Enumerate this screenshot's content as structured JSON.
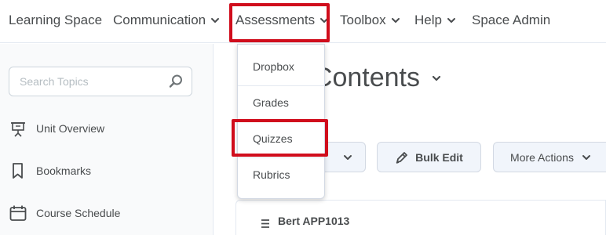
{
  "topnav": {
    "items": [
      {
        "label": "Learning Space",
        "has_menu": false
      },
      {
        "label": "Communication",
        "has_menu": true
      },
      {
        "label": "Assessments",
        "has_menu": true
      },
      {
        "label": "Toolbox",
        "has_menu": true
      },
      {
        "label": "Help",
        "has_menu": true
      },
      {
        "label": "Space Admin",
        "has_menu": false
      }
    ],
    "active_menu": "Assessments"
  },
  "assessments_menu": {
    "items": [
      {
        "label": "Dropbox"
      },
      {
        "label": "Grades"
      },
      {
        "label": "Quizzes"
      },
      {
        "label": "Rubrics"
      }
    ],
    "highlighted": "Quizzes"
  },
  "sidebar": {
    "search": {
      "placeholder": "Search Topics",
      "value": ""
    },
    "items": [
      {
        "label": "Unit Overview",
        "icon": "presentation-icon"
      },
      {
        "label": "Bookmarks",
        "icon": "bookmark-icon"
      },
      {
        "label": "Course Schedule",
        "icon": "calendar-icon"
      }
    ]
  },
  "main": {
    "title_visible": "f Contents",
    "bulk_edit_label": "Bulk Edit",
    "more_actions_label": "More Actions",
    "unit_label": "Bert APP1013"
  },
  "colors": {
    "highlight": "#d00d1c",
    "text": "#494c4e",
    "button_bg": "#f1f5fb"
  }
}
